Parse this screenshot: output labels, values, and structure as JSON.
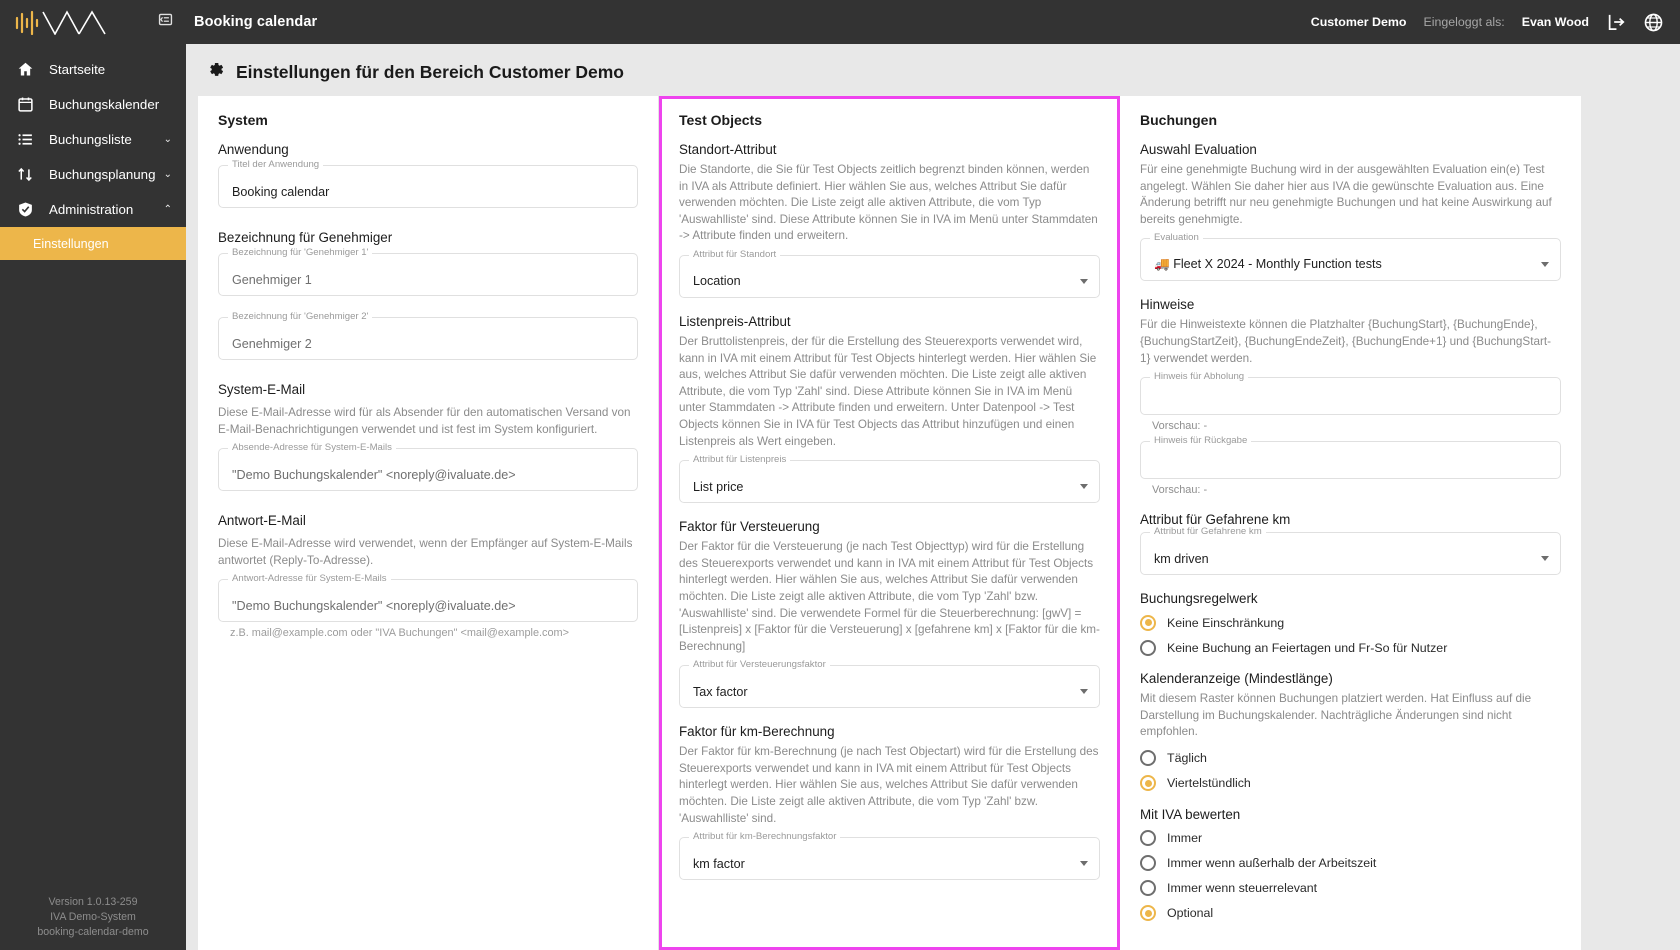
{
  "sidebar": {
    "logo_icon": "iva-logo-icon",
    "collapse_icon": "collapse-sidebar-icon",
    "items": [
      {
        "label": "Startseite",
        "icon": "home-icon",
        "chevron": "",
        "active": false
      },
      {
        "label": "Buchungskalender",
        "icon": "calendar-icon",
        "chevron": "",
        "active": false
      },
      {
        "label": "Buchungsliste",
        "icon": "list-icon",
        "chevron": "⌄",
        "active": false
      },
      {
        "label": "Buchungsplanung",
        "icon": "swap-icon",
        "chevron": "⌄",
        "active": false
      },
      {
        "label": "Administration",
        "icon": "shield-icon",
        "chevron": "⌃",
        "active": false
      }
    ],
    "sub_item": {
      "label": "Einstellungen"
    },
    "footer": {
      "version": "Version 1.0.13-259",
      "system": "IVA Demo-System",
      "instance": "booking-calendar-demo"
    }
  },
  "topbar": {
    "title": "Booking calendar",
    "tenant": "Customer Demo",
    "logged_in_label": "Eingeloggt als:",
    "user": "Evan Wood",
    "logout_icon": "logout-icon",
    "language_icon": "globe-icon"
  },
  "page": {
    "gear_icon": "gear-icon",
    "title": "Einstellungen für den Bereich Customer Demo"
  },
  "colors": {
    "accent": "#edb64a",
    "highlight_border": "#ee44ee",
    "sidebar_bg": "#333333",
    "content_bg": "#e8e8e8"
  },
  "system_panel": {
    "heading": "System",
    "anwendung": {
      "title": "Anwendung",
      "field_label": "Titel der Anwendung",
      "field_value": "Booking calendar"
    },
    "genehmiger": {
      "title": "Bezeichnung für Genehmiger",
      "field1_label": "Bezeichnung für 'Genehmiger 1'",
      "field1_value": "Genehmiger 1",
      "field2_label": "Bezeichnung für 'Genehmiger 2'",
      "field2_value": "Genehmiger 2"
    },
    "system_email": {
      "title": "System-E-Mail",
      "desc": "Diese E-Mail-Adresse wird für als Absender für den automatischen Versand von E-Mail-Benachrichtigungen verwendet und ist fest im System konfiguriert.",
      "field_label": "Absende-Adresse für System-E-Mails",
      "field_value": "\"Demo Buchungskalender\" <noreply@ivaluate.de>"
    },
    "reply_email": {
      "title": "Antwort-E-Mail",
      "desc": "Diese E-Mail-Adresse wird verwendet, wenn der Empfänger auf System-E-Mails antwortet (Reply-To-Adresse).",
      "field_label": "Antwort-Adresse für System-E-Mails",
      "field_value": "\"Demo Buchungskalender\" <noreply@ivaluate.de>",
      "hint": "z.B. mail@example.com oder \"IVA Buchungen\" <mail@example.com>"
    }
  },
  "test_objects_panel": {
    "heading": "Test Objects",
    "standort": {
      "title": "Standort-Attribut",
      "desc": "Die Standorte, die Sie für Test Objects zeitlich begrenzt binden können, werden in IVA als Attribute definiert. Hier wählen Sie aus, welches Attribut Sie dafür verwenden möchten. Die Liste zeigt alle aktiven Attribute, die vom Typ 'Auswahlliste' sind. Diese Attribute können Sie in IVA im Menü unter Stammdaten -> Attribute finden und erweitern.",
      "field_label": "Attribut für Standort",
      "field_value": "Location"
    },
    "listenpreis": {
      "title": "Listenpreis-Attribut",
      "desc": "Der Bruttolistenpreis, der für die Erstellung des Steuerexports verwendet wird, kann in IVA mit einem Attribut für Test Objects hinterlegt werden. Hier wählen Sie aus, welches Attribut Sie dafür verwenden möchten. Die Liste zeigt alle aktiven Attribute, die vom Typ 'Zahl' sind. Diese Attribute können Sie in IVA im Menü unter Stammdaten -> Attribute finden und erweitern. Unter Datenpool -> Test Objects können Sie in IVA für Test Objects das Attribut hinzufügen und einen Listenpreis als Wert eingeben.",
      "field_label": "Attribut für Listenpreis",
      "field_value": "List price"
    },
    "versteuerung": {
      "title": "Faktor für Versteuerung",
      "desc": "Der Faktor für die Versteuerung (je nach Test Objecttyp) wird für die Erstellung des Steuerexports verwendet und kann in IVA mit einem Attribut für Test Objects hinterlegt werden. Hier wählen Sie aus, welches Attribut Sie dafür verwenden möchten. Die Liste zeigt alle aktiven Attribute, die vom Typ 'Zahl' bzw. 'Auswahlliste' sind. Die verwendete Formel für die Steuerberechnung: [gwV] = [Listenpreis] x [Faktor für die Versteuerung] x [gefahrene km] x [Faktor für die km-Berechnung]",
      "field_label": "Attribut für Versteuerungsfaktor",
      "field_value": "Tax factor"
    },
    "km_berechnung": {
      "title": "Faktor für km-Berechnung",
      "desc": "Der Faktor für km-Berechnung (je nach Test Objectart) wird für die Erstellung des Steuerexports verwendet und kann in IVA mit einem Attribut für Test Objects hinterlegt werden. Hier wählen Sie aus, welches Attribut Sie dafür verwenden möchten. Die Liste zeigt alle aktiven Attribute, die vom Typ 'Zahl' bzw. 'Auswahlliste' sind.",
      "field_label": "Attribut für km-Berechnungsfaktor",
      "field_value": "km factor"
    }
  },
  "bookings_panel": {
    "heading": "Buchungen",
    "evaluation": {
      "title": "Auswahl Evaluation",
      "desc": "Für eine genehmigte Buchung wird in der ausgewählten Evaluation ein(e) Test angelegt. Wählen Sie daher hier aus IVA die gewünschte Evaluation aus. Eine Änderung betrifft nur neu genehmigte Buchungen und hat keine Auswirkung auf bereits genehmigte.",
      "field_label": "Evaluation",
      "field_icon": "car-emoji",
      "field_value": "Fleet X 2024 - Monthly Function tests"
    },
    "hinweise": {
      "title": "Hinweise",
      "desc": "Für die Hinweistexte können die Platzhalter {BuchungStart}, {BuchungEnde}, {BuchungStartZeit}, {BuchungEndeZeit}, {BuchungEnde+1} und {BuchungStart-1} verwendet werden.",
      "pickup_label": "Hinweis für Abholung",
      "pickup_value": "",
      "pickup_preview": "Vorschau: -",
      "return_label": "Hinweis für Rückgabe",
      "return_value": "",
      "return_preview": "Vorschau: -"
    },
    "gefahrene_km": {
      "title": "Attribut für Gefahrene km",
      "field_label": "Attribut für Gefahrene km",
      "field_value": "km driven"
    },
    "regelwerk": {
      "title": "Buchungsregelwerk",
      "options": [
        {
          "label": "Keine Einschränkung",
          "selected": true
        },
        {
          "label": "Keine Buchung an Feiertagen und Fr-So für Nutzer",
          "selected": false
        }
      ]
    },
    "kalenderanzeige": {
      "title": "Kalenderanzeige (Mindestlänge)",
      "desc": "Mit diesem Raster können Buchungen platziert werden. Hat Einfluss auf die Darstellung im Buchungskalender. Nachträgliche Änderungen sind nicht empfohlen.",
      "options": [
        {
          "label": "Täglich",
          "selected": false
        },
        {
          "label": "Viertelstündlich",
          "selected": true
        }
      ]
    },
    "iva_bewerten": {
      "title": "Mit IVA bewerten",
      "options": [
        {
          "label": "Immer",
          "selected": false
        },
        {
          "label": "Immer wenn außerhalb der Arbeitszeit",
          "selected": false
        },
        {
          "label": "Immer wenn steuerrelevant",
          "selected": false
        },
        {
          "label": "Optional",
          "selected": true
        }
      ]
    }
  }
}
